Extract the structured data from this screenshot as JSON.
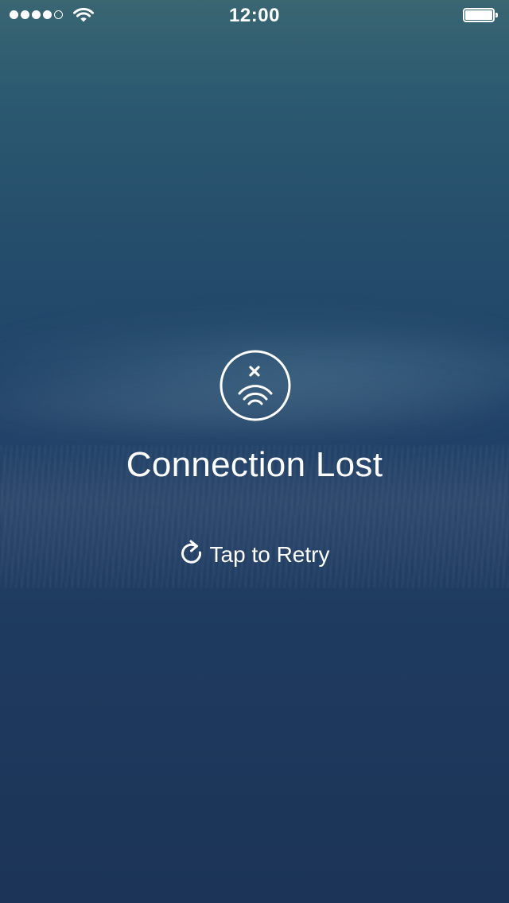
{
  "status_bar": {
    "time": "12:00",
    "signal_bars_filled": 4,
    "signal_bars_total": 5,
    "wifi_icon": "wifi-icon",
    "battery_icon": "battery-full-icon",
    "battery_level": 1.0
  },
  "error": {
    "icon": "no-connection-icon",
    "title": "Connection Lost"
  },
  "retry": {
    "icon": "refresh-icon",
    "label": "Tap to Retry"
  },
  "colors": {
    "text": "#ffffff",
    "background_top": "#3a6672",
    "background_bottom": "#1b3457"
  }
}
